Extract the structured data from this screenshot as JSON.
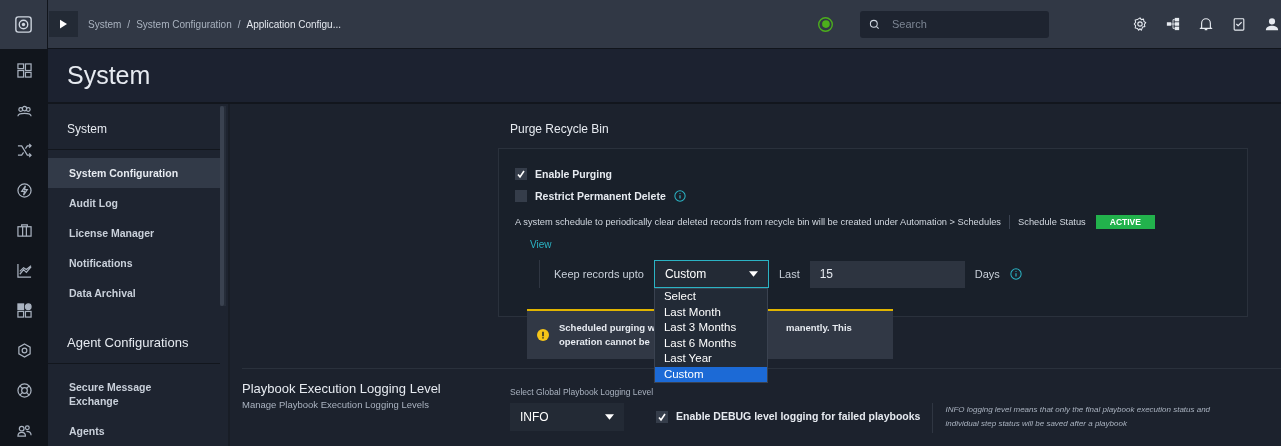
{
  "topbar": {
    "breadcrumbs": [
      {
        "label": "System",
        "current": false
      },
      {
        "label": "System Configuration",
        "current": false
      },
      {
        "label": "Application Configu...",
        "current": true
      }
    ],
    "separator": "/",
    "search": {
      "placeholder": "Search"
    }
  },
  "page_title": "System",
  "sidebar": {
    "sections": [
      {
        "title": "System",
        "items": [
          {
            "label": "System Configuration",
            "selected": true
          },
          {
            "label": "Audit Log",
            "selected": false
          },
          {
            "label": "License Manager",
            "selected": false
          },
          {
            "label": "Notifications",
            "selected": false
          },
          {
            "label": "Data Archival",
            "selected": false
          }
        ]
      },
      {
        "title": "Agent Configurations",
        "items": [
          {
            "label": "Secure Message Exchange",
            "selected": false
          },
          {
            "label": "Agents",
            "selected": false
          }
        ]
      }
    ]
  },
  "purge": {
    "title": "Purge Recycle Bin",
    "checkboxes": [
      {
        "label": "Enable Purging",
        "checked": true,
        "info": false
      },
      {
        "label": "Restrict Permanent Delete",
        "checked": false,
        "info": true
      }
    ],
    "schedule_text": "A system schedule to periodically clear deleted records from recycle bin will be created under Automation > Schedules",
    "schedule_status_label": "Schedule Status",
    "schedule_status": "ACTIVE",
    "view_link": "View",
    "keep_label": "Keep records upto",
    "keep_select": {
      "value": "Custom",
      "expanded": true,
      "options": [
        {
          "label": "Select",
          "selected": false
        },
        {
          "label": "Last Month",
          "selected": false
        },
        {
          "label": "Last 3 Months",
          "selected": false
        },
        {
          "label": "Last 6 Months",
          "selected": false
        },
        {
          "label": "Last Year",
          "selected": false
        },
        {
          "label": "Custom",
          "selected": true
        }
      ]
    },
    "last_label": "Last",
    "last_value": "15",
    "days_label": "Days",
    "warning": {
      "line1_start": "Scheduled purging w",
      "line1_end": "manently. This",
      "line2": "operation cannot be"
    }
  },
  "logging": {
    "title": "Playbook Execution Logging Level",
    "subtitle": "Manage Playbook Execution Logging Levels",
    "select_label": "Select Global Playbook Logging Level",
    "select_value": "INFO",
    "debug_checkbox": {
      "label": "Enable DEBUG level logging for failed playbooks",
      "checked": true
    },
    "note": "INFO logging level means that only the final playbook execution status and individual step status will be saved after a playbook"
  }
}
